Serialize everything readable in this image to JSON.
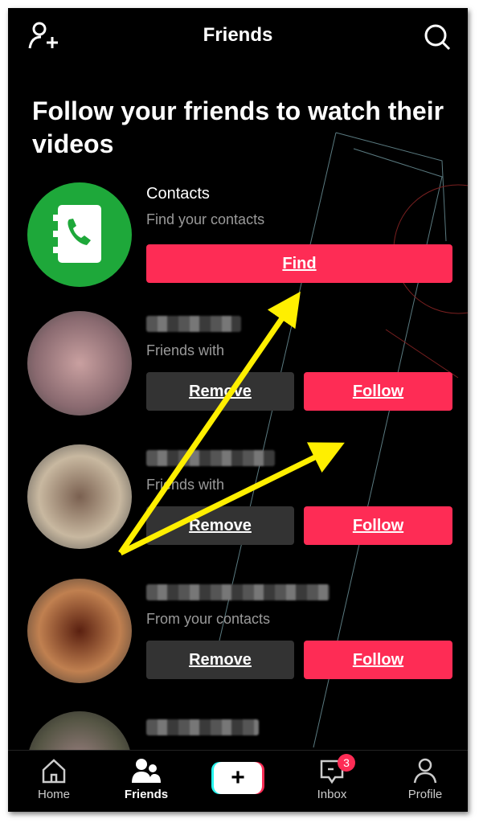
{
  "header": {
    "title": "Friends"
  },
  "heading": "Follow your friends to watch their videos",
  "contacts": {
    "title": "Contacts",
    "subtitle": "Find your contacts",
    "button": "Find"
  },
  "suggestions": [
    {
      "subtitle": "Friends with",
      "remove": "Remove",
      "follow": "Follow"
    },
    {
      "subtitle": "Friends with",
      "remove": "Remove",
      "follow": "Follow"
    },
    {
      "subtitle": "From your contacts",
      "remove": "Remove",
      "follow": "Follow"
    }
  ],
  "nav": {
    "home": "Home",
    "friends": "Friends",
    "inbox": "Inbox",
    "inbox_badge": "3",
    "profile": "Profile"
  },
  "colors": {
    "accent": "#fe2c55",
    "contacts_green": "#1ea83a",
    "annotation_arrow": "#ffef00"
  }
}
